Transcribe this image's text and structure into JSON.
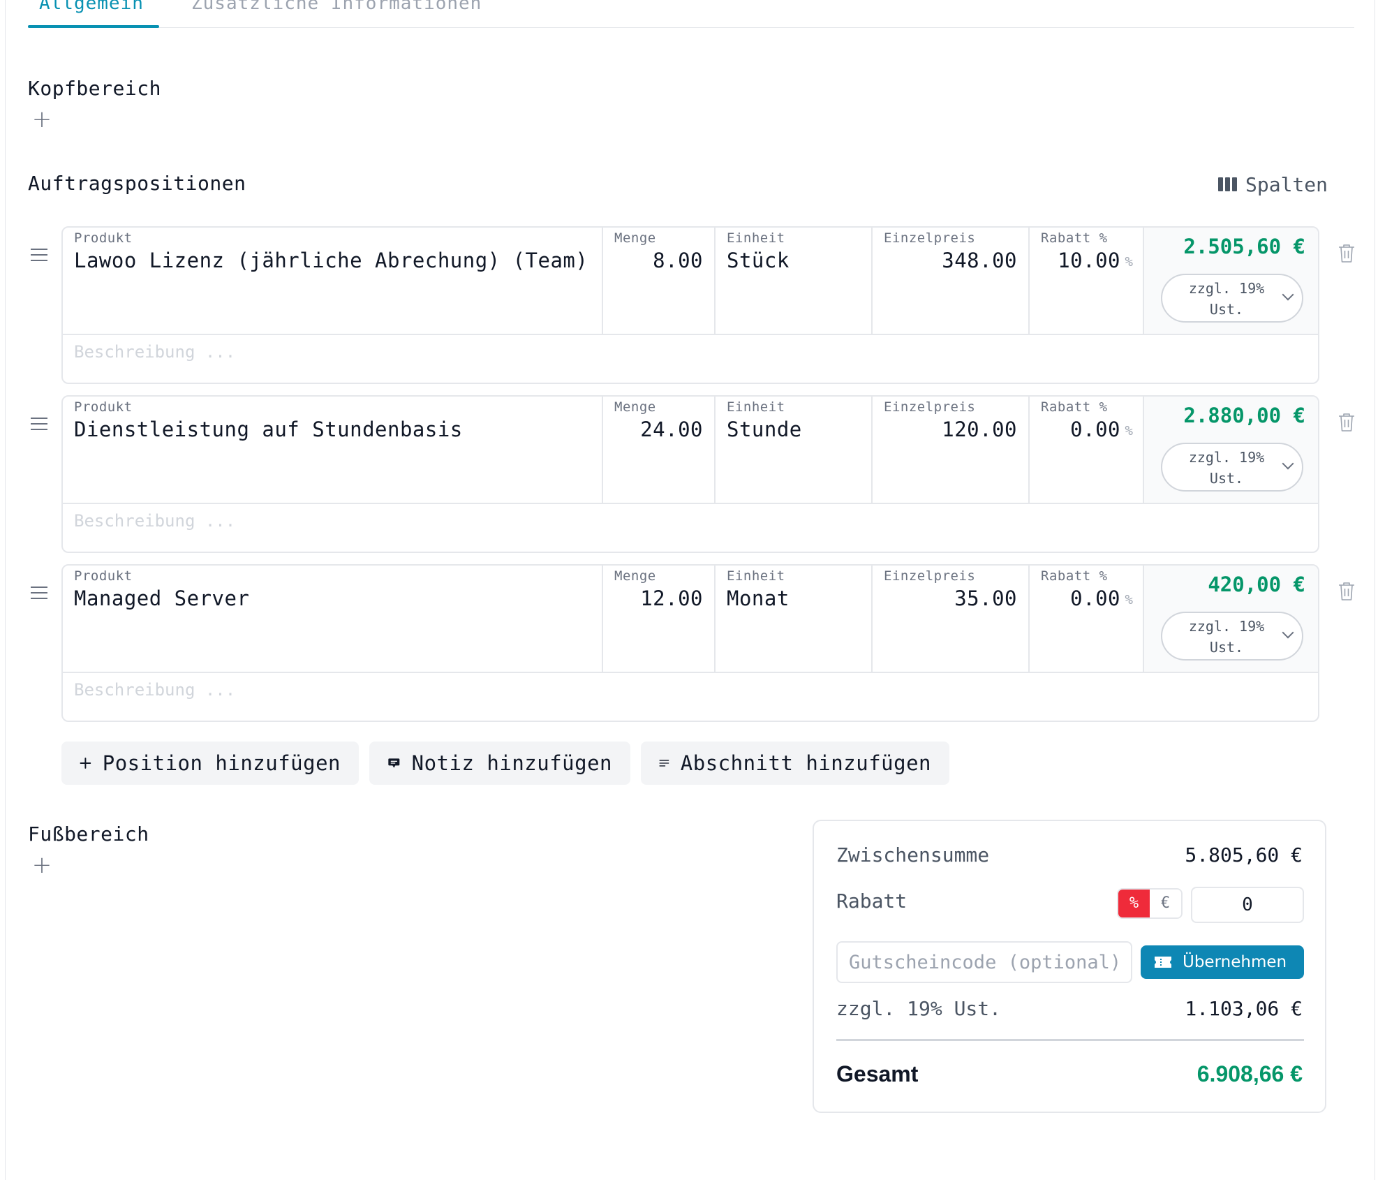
{
  "tabs": [
    {
      "label": "Allgemein"
    },
    {
      "label": "Zusätzliche Informationen"
    }
  ],
  "header_section": {
    "title": "Kopfbereich"
  },
  "positions_section": {
    "title": "Auftragspositionen",
    "columns_label": "Spalten"
  },
  "column_labels": {
    "product": "Produkt",
    "quantity": "Menge",
    "unit": "Einheit",
    "unit_price": "Einzelpreis",
    "discount": "Rabatt %",
    "percent_sign": "%",
    "description_placeholder": "Beschreibung ..."
  },
  "positions": [
    {
      "product": "Lawoo Lizenz (jährliche Abrechung) (Team)",
      "quantity": "8.00",
      "unit": "Stück",
      "unit_price": "348.00",
      "discount": "10.00",
      "total": "2.505,60 €",
      "tax": "zzgl. 19%\nUst."
    },
    {
      "product": "Dienstleistung auf Stundenbasis",
      "quantity": "24.00",
      "unit": "Stunde",
      "unit_price": "120.00",
      "discount": "0.00",
      "total": "2.880,00 €",
      "tax": "zzgl. 19%\nUst."
    },
    {
      "product": "Managed Server",
      "quantity": "12.00",
      "unit": "Monat",
      "unit_price": "35.00",
      "discount": "0.00",
      "total": "420,00 €",
      "tax": "zzgl. 19%\nUst."
    }
  ],
  "actions": {
    "add_position": "Position hinzufügen",
    "add_note": "Notiz hinzufügen",
    "add_section": "Abschnitt hinzufügen"
  },
  "footer_section": {
    "title": "Fußbereich"
  },
  "totals": {
    "subtotal_label": "Zwischensumme",
    "subtotal_value": "5.805,60 €",
    "discount_label": "Rabatt",
    "discount_percent": "%",
    "discount_euro": "€",
    "discount_value": "0",
    "voucher_placeholder": "Gutscheincode (optional)",
    "apply_label": "Übernehmen",
    "tax_label": "zzgl. 19% Ust.",
    "tax_value": "1.103,06 €",
    "grand_label": "Gesamt",
    "grand_value": "6.908,66 €"
  },
  "colors": {
    "accent": "#0891b2",
    "total_green": "#059669",
    "discount_active": "#ef2b3a",
    "apply_button": "#0e87b4"
  }
}
